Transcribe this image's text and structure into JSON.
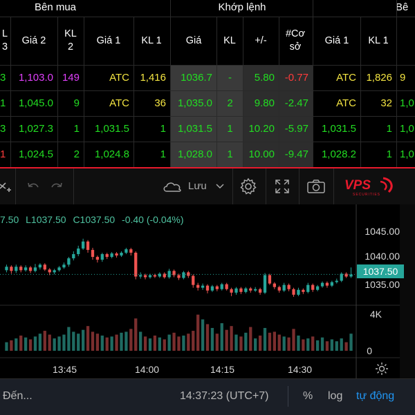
{
  "board": {
    "groups": {
      "buy": "Bên mua",
      "match": "Khớp lệnh",
      "sell": "Bê"
    },
    "headers": {
      "kl3": [
        "L",
        "3"
      ],
      "gia2": "Giá 2",
      "kl2": [
        "KL",
        "2"
      ],
      "gia1": "Giá 1",
      "kl1": "KL 1",
      "match_price": "Giá",
      "match_vol": "KL",
      "change": "+/-",
      "basis": [
        "#Cơ",
        "sở"
      ],
      "sell_gia1": "Giá 1",
      "sell_kl1": "KL 1",
      "sell_gia2": ""
    },
    "rows": [
      {
        "kl3": "3",
        "gia2": "1,103.0",
        "kl2": "149",
        "gia1": "ATC",
        "kl1": "1,416",
        "price": "1036.7",
        "vol": "-",
        "change": "5.80",
        "basis": "-0.77",
        "s_gia1": "ATC",
        "s_kl1": "1,826",
        "s_gia2": "9"
      },
      {
        "kl3": "1",
        "gia2": "1,045.0",
        "kl2": "9",
        "gia1": "ATC",
        "kl1": "36",
        "price": "1,035.0",
        "vol": "2",
        "change": "9.80",
        "basis": "-2.47",
        "s_gia1": "ATC",
        "s_kl1": "32",
        "s_gia2": "1,0"
      },
      {
        "kl3": "3",
        "gia2": "1,027.3",
        "kl2": "1",
        "gia1": "1,031.5",
        "kl1": "1",
        "price": "1,031.5",
        "vol": "1",
        "change": "10.20",
        "basis": "-5.97",
        "s_gia1": "1,031.5",
        "s_kl1": "1",
        "s_gia2": "1,0"
      },
      {
        "kl3": "1",
        "gia2": "1,024.5",
        "kl2": "2",
        "gia1": "1,024.8",
        "kl1": "1",
        "price": "1,028.0",
        "vol": "1",
        "change": "10.00",
        "basis": "-9.47",
        "s_gia1": "1,028.2",
        "s_kl1": "1",
        "s_gia2": "1,0"
      }
    ]
  },
  "toolbar": {
    "save_label": "Lưu",
    "logo_text": "VPS",
    "logo_sub": "SECURITIES"
  },
  "chart": {
    "legend": {
      "close_partial": "7.50",
      "low": "L1037.50",
      "close": "C1037.50",
      "change": "-0.40 (-0.04%)"
    },
    "price_axis": [
      "1045.00",
      "1040.00",
      "1035.00"
    ],
    "last_price": "1037.50",
    "volume_axis": [
      "4K",
      "0"
    ],
    "time_axis": [
      "13:45",
      "14:00",
      "14:15",
      "14:30"
    ],
    "colors": {
      "up": "#26a69a",
      "down": "#ef5350",
      "accent": "#e8192c"
    }
  },
  "chart_data": {
    "type": "candlestick",
    "price_range": [
      1033.5,
      1047.5
    ],
    "volume_range": [
      0,
      4500
    ],
    "candles": [
      {
        "o": 1038.1,
        "c": 1038.6,
        "h": 1038.9,
        "l": 1037.8,
        "v": 900
      },
      {
        "o": 1038.6,
        "c": 1038.0,
        "h": 1038.8,
        "l": 1037.6,
        "v": 1100
      },
      {
        "o": 1038.0,
        "c": 1038.6,
        "h": 1038.9,
        "l": 1037.7,
        "v": 1300
      },
      {
        "o": 1038.6,
        "c": 1038.1,
        "h": 1038.8,
        "l": 1037.8,
        "v": 1600
      },
      {
        "o": 1038.1,
        "c": 1038.5,
        "h": 1038.8,
        "l": 1037.9,
        "v": 1400
      },
      {
        "o": 1038.5,
        "c": 1038.0,
        "h": 1038.7,
        "l": 1037.7,
        "v": 1200
      },
      {
        "o": 1038.0,
        "c": 1038.5,
        "h": 1039.0,
        "l": 1037.8,
        "v": 1500
      },
      {
        "o": 1038.5,
        "c": 1038.9,
        "h": 1039.1,
        "l": 1038.2,
        "v": 1800
      },
      {
        "o": 1038.9,
        "c": 1038.2,
        "h": 1039.1,
        "l": 1038.0,
        "v": 2100
      },
      {
        "o": 1038.2,
        "c": 1037.8,
        "h": 1038.4,
        "l": 1037.4,
        "v": 1700
      },
      {
        "o": 1037.8,
        "c": 1038.1,
        "h": 1038.3,
        "l": 1037.5,
        "v": 1300
      },
      {
        "o": 1038.1,
        "c": 1038.5,
        "h": 1038.7,
        "l": 1037.9,
        "v": 1500
      },
      {
        "o": 1038.5,
        "c": 1038.9,
        "h": 1039.2,
        "l": 1038.3,
        "v": 1700
      },
      {
        "o": 1038.9,
        "c": 1039.8,
        "h": 1040.0,
        "l": 1038.6,
        "v": 2500
      },
      {
        "o": 1039.8,
        "c": 1040.4,
        "h": 1040.8,
        "l": 1039.5,
        "v": 2000
      },
      {
        "o": 1040.4,
        "c": 1041.2,
        "h": 1041.6,
        "l": 1040.1,
        "v": 1800
      },
      {
        "o": 1041.2,
        "c": 1042.2,
        "h": 1042.6,
        "l": 1041.0,
        "v": 2200
      },
      {
        "o": 1042.2,
        "c": 1041.0,
        "h": 1042.4,
        "l": 1040.6,
        "v": 2600
      },
      {
        "o": 1041.0,
        "c": 1040.0,
        "h": 1041.3,
        "l": 1039.6,
        "v": 2000
      },
      {
        "o": 1040.0,
        "c": 1039.6,
        "h": 1040.2,
        "l": 1039.2,
        "v": 1800
      },
      {
        "o": 1039.6,
        "c": 1040.4,
        "h": 1040.6,
        "l": 1039.3,
        "v": 1600
      },
      {
        "o": 1040.4,
        "c": 1040.0,
        "h": 1040.6,
        "l": 1039.7,
        "v": 1400
      },
      {
        "o": 1040.0,
        "c": 1040.5,
        "h": 1040.7,
        "l": 1039.8,
        "v": 1500
      },
      {
        "o": 1040.5,
        "c": 1040.2,
        "h": 1040.7,
        "l": 1039.9,
        "v": 1700
      },
      {
        "o": 1040.2,
        "c": 1040.6,
        "h": 1040.8,
        "l": 1040.0,
        "v": 1900
      },
      {
        "o": 1040.6,
        "c": 1041.1,
        "h": 1041.3,
        "l": 1040.4,
        "v": 2000
      },
      {
        "o": 1041.1,
        "c": 1040.6,
        "h": 1041.3,
        "l": 1040.2,
        "v": 2300
      },
      {
        "o": 1040.6,
        "c": 1037.2,
        "h": 1040.8,
        "l": 1036.8,
        "v": 3400
      },
      {
        "o": 1037.2,
        "c": 1037.4,
        "h": 1037.8,
        "l": 1036.9,
        "v": 2000
      },
      {
        "o": 1037.4,
        "c": 1037.1,
        "h": 1037.6,
        "l": 1036.8,
        "v": 1500
      },
      {
        "o": 1037.1,
        "c": 1037.4,
        "h": 1037.6,
        "l": 1036.9,
        "v": 1300
      },
      {
        "o": 1037.4,
        "c": 1037.2,
        "h": 1037.6,
        "l": 1037.0,
        "v": 1600
      },
      {
        "o": 1037.2,
        "c": 1037.6,
        "h": 1037.8,
        "l": 1037.0,
        "v": 1400
      },
      {
        "o": 1037.6,
        "c": 1037.1,
        "h": 1037.8,
        "l": 1036.9,
        "v": 1200
      },
      {
        "o": 1037.1,
        "c": 1038.0,
        "h": 1038.3,
        "l": 1036.9,
        "v": 1700
      },
      {
        "o": 1038.0,
        "c": 1037.4,
        "h": 1038.2,
        "l": 1037.1,
        "v": 1900
      },
      {
        "o": 1037.4,
        "c": 1037.0,
        "h": 1037.6,
        "l": 1036.7,
        "v": 1500
      },
      {
        "o": 1037.0,
        "c": 1037.8,
        "h": 1038.0,
        "l": 1036.8,
        "v": 1600
      },
      {
        "o": 1037.8,
        "c": 1037.3,
        "h": 1038.0,
        "l": 1037.0,
        "v": 1800
      },
      {
        "o": 1037.3,
        "c": 1036.0,
        "h": 1037.5,
        "l": 1035.6,
        "v": 2100
      },
      {
        "o": 1036.0,
        "c": 1035.6,
        "h": 1036.3,
        "l": 1035.2,
        "v": 3800
      },
      {
        "o": 1035.6,
        "c": 1035.9,
        "h": 1036.2,
        "l": 1035.3,
        "v": 3300
      },
      {
        "o": 1035.9,
        "c": 1035.2,
        "h": 1036.1,
        "l": 1034.8,
        "v": 2800
      },
      {
        "o": 1035.2,
        "c": 1035.8,
        "h": 1036.0,
        "l": 1035.0,
        "v": 2400
      },
      {
        "o": 1035.8,
        "c": 1035.4,
        "h": 1036.0,
        "l": 1035.1,
        "v": 1800
      },
      {
        "o": 1035.4,
        "c": 1036.1,
        "h": 1036.3,
        "l": 1035.2,
        "v": 2900
      },
      {
        "o": 1036.1,
        "c": 1035.4,
        "h": 1036.3,
        "l": 1035.2,
        "v": 2200
      },
      {
        "o": 1035.4,
        "c": 1034.9,
        "h": 1035.6,
        "l": 1034.4,
        "v": 2600
      },
      {
        "o": 1034.9,
        "c": 1035.5,
        "h": 1035.7,
        "l": 1034.6,
        "v": 1700
      },
      {
        "o": 1035.5,
        "c": 1035.0,
        "h": 1035.7,
        "l": 1034.7,
        "v": 1500
      },
      {
        "o": 1035.0,
        "c": 1035.5,
        "h": 1035.7,
        "l": 1034.8,
        "v": 1900
      },
      {
        "o": 1035.5,
        "c": 1035.2,
        "h": 1035.7,
        "l": 1034.9,
        "v": 2500
      },
      {
        "o": 1035.2,
        "c": 1035.4,
        "h": 1035.7,
        "l": 1035.0,
        "v": 1300
      },
      {
        "o": 1035.4,
        "c": 1034.9,
        "h": 1035.6,
        "l": 1034.6,
        "v": 1600
      },
      {
        "o": 1034.9,
        "c": 1037.4,
        "h": 1037.7,
        "l": 1034.7,
        "v": 2400
      },
      {
        "o": 1037.4,
        "c": 1036.2,
        "h": 1037.6,
        "l": 1036.0,
        "v": 1900
      },
      {
        "o": 1036.2,
        "c": 1035.7,
        "h": 1036.4,
        "l": 1035.4,
        "v": 2000
      },
      {
        "o": 1035.7,
        "c": 1035.2,
        "h": 1035.9,
        "l": 1034.9,
        "v": 1700
      },
      {
        "o": 1035.2,
        "c": 1036.0,
        "h": 1036.3,
        "l": 1035.0,
        "v": 1500
      },
      {
        "o": 1036.0,
        "c": 1035.4,
        "h": 1036.2,
        "l": 1035.1,
        "v": 1400
      },
      {
        "o": 1035.4,
        "c": 1034.6,
        "h": 1035.6,
        "l": 1034.3,
        "v": 2300
      },
      {
        "o": 1034.6,
        "c": 1035.3,
        "h": 1035.6,
        "l": 1034.4,
        "v": 1600
      },
      {
        "o": 1035.3,
        "c": 1035.0,
        "h": 1035.5,
        "l": 1034.7,
        "v": 1200
      },
      {
        "o": 1035.0,
        "c": 1036.0,
        "h": 1036.3,
        "l": 1034.8,
        "v": 1300
      },
      {
        "o": 1036.0,
        "c": 1035.3,
        "h": 1036.2,
        "l": 1035.0,
        "v": 1500
      },
      {
        "o": 1035.3,
        "c": 1035.8,
        "h": 1036.0,
        "l": 1035.1,
        "v": 1100
      },
      {
        "o": 1035.8,
        "c": 1036.3,
        "h": 1036.5,
        "l": 1035.6,
        "v": 1400
      },
      {
        "o": 1036.3,
        "c": 1035.9,
        "h": 1036.5,
        "l": 1035.6,
        "v": 1000
      },
      {
        "o": 1035.9,
        "c": 1036.4,
        "h": 1036.6,
        "l": 1035.7,
        "v": 1200
      },
      {
        "o": 1036.4,
        "c": 1036.6,
        "h": 1036.9,
        "l": 1036.2,
        "v": 1000
      },
      {
        "o": 1036.6,
        "c": 1037.6,
        "h": 1037.8,
        "l": 1036.4,
        "v": 1300
      },
      {
        "o": 1037.6,
        "c": 1037.2,
        "h": 1037.8,
        "l": 1037.0,
        "v": 900
      },
      {
        "o": 1037.2,
        "c": 1037.5,
        "h": 1038.5,
        "l": 1037.0,
        "v": 1800
      }
    ]
  },
  "status": {
    "left_text": "Đến...",
    "time": "14:37:23 (UTC+7)",
    "percent": "%",
    "log": "log",
    "auto": "tự động"
  }
}
